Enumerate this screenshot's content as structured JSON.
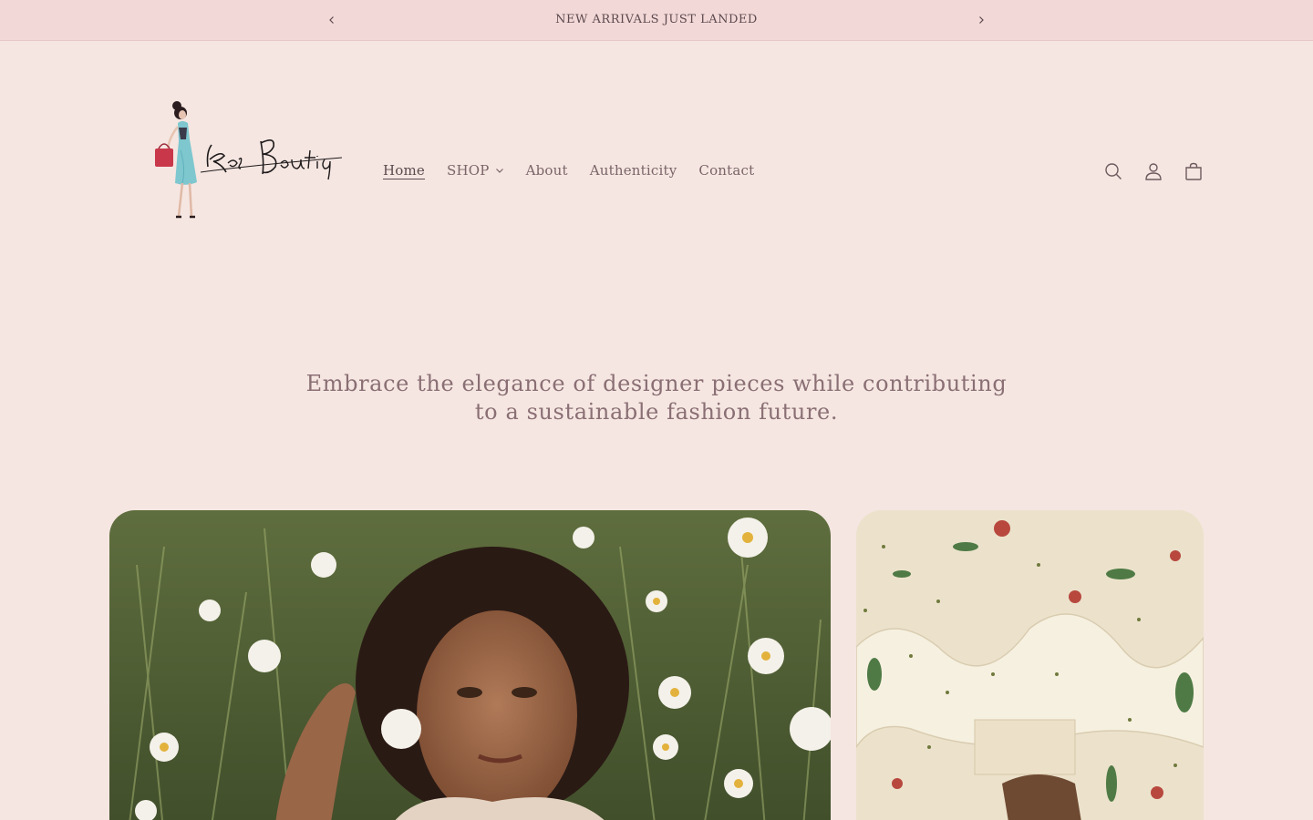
{
  "announcement": {
    "text": "NEW ARRIVALS JUST LANDED",
    "prev_icon": "chevron-left-icon",
    "next_icon": "chevron-right-icon"
  },
  "logo": {
    "text": "Ko's Boutiq"
  },
  "nav": {
    "items": [
      {
        "label": "Home",
        "active": true
      },
      {
        "label": "SHOP",
        "has_dropdown": true
      },
      {
        "label": "About"
      },
      {
        "label": "Authenticity"
      },
      {
        "label": "Contact"
      }
    ]
  },
  "header_icons": [
    "search-icon",
    "account-icon",
    "cart-icon"
  ],
  "hero": {
    "tagline": "Embrace the elegance of designer pieces while contributing to a sustainable fashion future."
  },
  "colors": {
    "background": "#f5e6e1",
    "announcement_bg": "#f2d8d7",
    "text": "#6e5a5e",
    "tagline": "#8a6f74"
  }
}
